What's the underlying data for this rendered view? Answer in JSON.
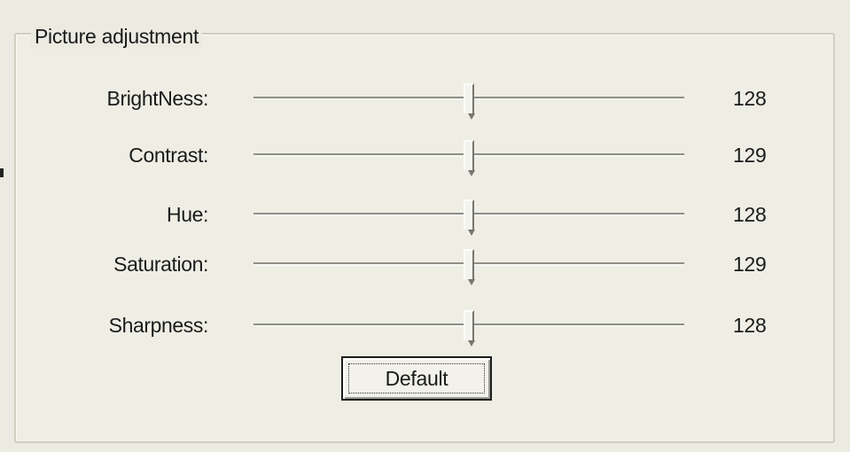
{
  "group": {
    "title": "Picture adjustment"
  },
  "sliders": [
    {
      "label": "BrightNess:",
      "value": "128",
      "position": 0.5
    },
    {
      "label": "Contrast:",
      "value": "129",
      "position": 0.5
    },
    {
      "label": "Hue:",
      "value": "128",
      "position": 0.5
    },
    {
      "label": "Saturation:",
      "value": "129",
      "position": 0.5
    },
    {
      "label": "Sharpness:",
      "value": "128",
      "position": 0.5
    }
  ],
  "buttons": {
    "default_label": "Default"
  }
}
